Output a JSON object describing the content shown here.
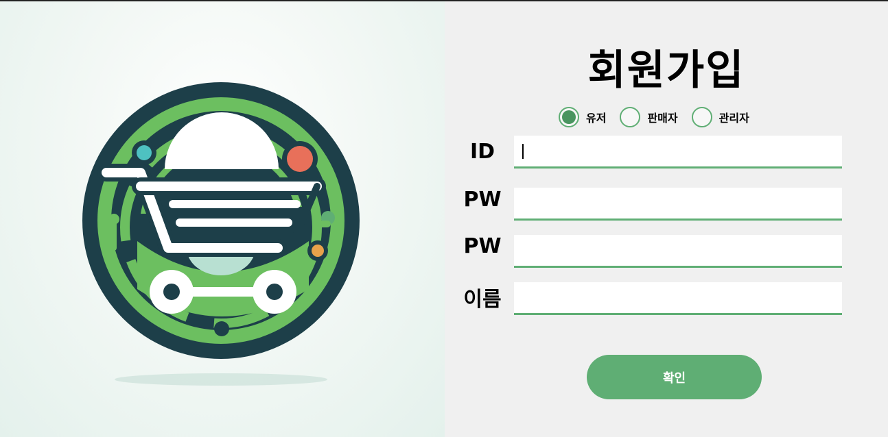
{
  "signup": {
    "title": "회원가입",
    "roles": [
      {
        "label": "유저",
        "selected": true
      },
      {
        "label": "판매자",
        "selected": false
      },
      {
        "label": "관리자",
        "selected": false
      }
    ],
    "fields": [
      {
        "label": "ID",
        "value": ""
      },
      {
        "label": "PW",
        "value": ""
      },
      {
        "label": "PW",
        "value": ""
      },
      {
        "label": "이름",
        "value": ""
      }
    ],
    "confirm_label": "확인"
  },
  "logo": {
    "icon": "shopping-cart-logo",
    "colors": {
      "dark": "#1d3f49",
      "green": "#6cbf60",
      "light_green": "#8ed26f",
      "red_dot": "#e8705a",
      "teal_dot": "#4ec1c1",
      "orange_dot": "#e8a24b",
      "white": "#ffffff"
    }
  },
  "colors": {
    "accent": "#5fae74",
    "accent_dark": "#4a9560",
    "background": "#f0f0f0"
  }
}
